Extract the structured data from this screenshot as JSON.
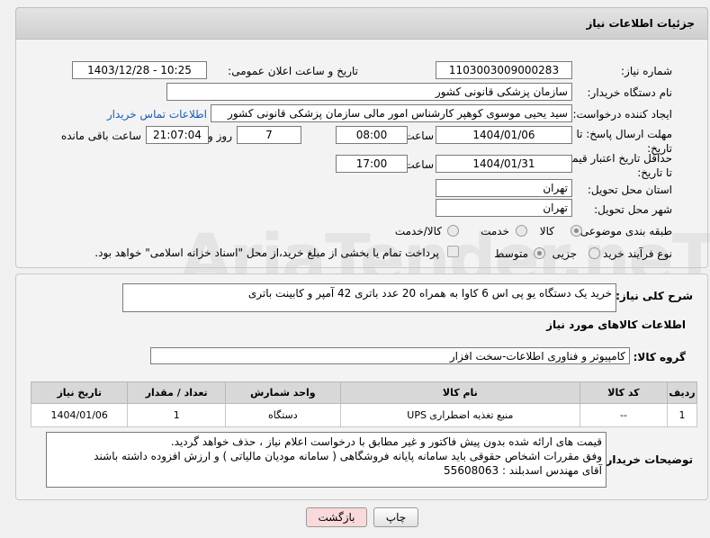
{
  "header": {
    "title": "جزئیات اطلاعات نیاز"
  },
  "need_number": {
    "label": "شماره نیاز:",
    "value": "1103003009000283"
  },
  "announce": {
    "label": "تاریخ و ساعت اعلان عمومی:",
    "value": "1403/12/28 - 10:25"
  },
  "buyer_org": {
    "label": "نام دستگاه خریدار:",
    "value": "سازمان پزشکی قانونی کشور"
  },
  "requester": {
    "label": "ایجاد کننده درخواست:",
    "value": "سید یحیی موسوی کوهپر کارشناس امور مالی سازمان پزشکی قانونی کشور",
    "contact_link": "اطلاعات تماس خریدار"
  },
  "reply_deadline": {
    "label": "مهلت ارسال پاسخ: تا تاریخ:",
    "date": "1404/01/06",
    "time_label": "ساعت",
    "time": "08:00",
    "days": "7",
    "days_label": "روز و",
    "remaining": "21:07:04",
    "remaining_label": "ساعت باقی مانده"
  },
  "price_validity": {
    "label": "حداقل تاریخ اعتبار قیمت: تا تاریخ:",
    "date": "1404/01/31",
    "time_label": "ساعت",
    "time": "17:00"
  },
  "province": {
    "label": "استان محل تحویل:",
    "value": "تهران"
  },
  "city": {
    "label": "شهر محل تحویل:",
    "value": "تهران"
  },
  "category": {
    "label": "طبقه بندی موضوعی:",
    "options": [
      "کالا",
      "خدمت",
      "کالا/خدمت"
    ]
  },
  "purchase_type": {
    "label": "نوع فرآیند خرید :",
    "options": [
      "جزیی",
      "متوسط"
    ],
    "note": "پرداخت تمام یا بخشی از مبلغ خرید،از محل \"اسناد خزانه اسلامی\" خواهد بود."
  },
  "summary": {
    "label": "شرح کلی نیاز:",
    "value": "خرید یک دستگاه  یو پی اس  6 کاوا به همراه 20 عدد باتری 42 آمپر و کابینت باتری"
  },
  "goods_info": {
    "title": "اطلاعات کالاهای مورد نیاز"
  },
  "goods_group": {
    "label": "گروه کالا:",
    "value": "کامپیوتر و فناوری اطلاعات-سخت افزار"
  },
  "table": {
    "headers": [
      "ردیف",
      "کد کالا",
      "نام کالا",
      "واحد شمارش",
      "تعداد / مقدار",
      "تاریخ نیاز"
    ],
    "rows": [
      [
        "1",
        "--",
        "منبع تغذیه اضطراری UPS",
        "دستگاه",
        "1",
        "1404/01/06"
      ]
    ]
  },
  "buyer_notes": {
    "label": "توضیحات خریدار:",
    "lines": [
      "قیمت های ارائه شده بدون پیش فاکتور  و غیر مطابق با درخواست اعلام نیاز  ،  حذف خواهد گردید.",
      "وفق مقررات اشخاص حقوقی باید سامانه پایانه فروشگاهی ( سامانه مودیان مالیاتی ) و ارزش افزوده  داشته باشند",
      "آقای مهندس اسدبلند :         55608063"
    ]
  },
  "buttons": {
    "print": "چاپ",
    "back": "بازگشت"
  },
  "watermark": "AriaTender.neT",
  "colors": {
    "link": "#1a5db8",
    "back_button_bg": "#f9d9d9"
  }
}
